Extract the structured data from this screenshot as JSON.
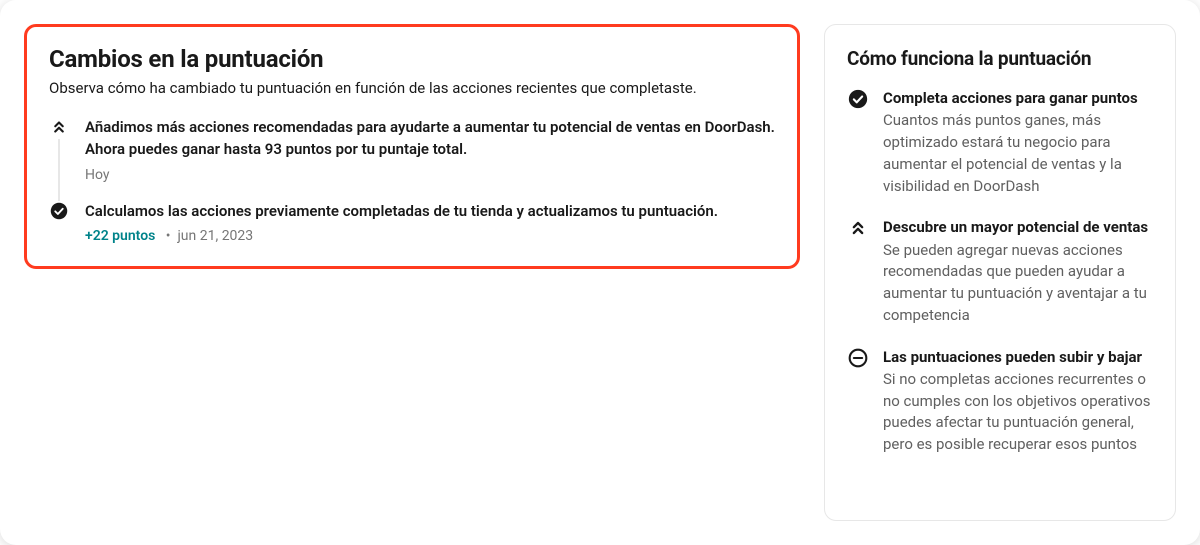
{
  "left": {
    "title": "Cambios en la puntuación",
    "subtitle": "Observa cómo ha cambiado tu puntuación en función de las acciones recientes que completaste.",
    "timeline": [
      {
        "icon": "chevrons-up",
        "text": "Añadimos más acciones recomendadas para ayudarte a aumentar tu potencial de ventas en DoorDash. Ahora puedes ganar hasta 93 puntos por tu puntaje total.",
        "date": "Hoy",
        "points": ""
      },
      {
        "icon": "check-filled",
        "text": "Calculamos las acciones previamente completadas de tu tienda y actualizamos tu puntuación.",
        "date": "jun 21, 2023",
        "points": "+22 puntos"
      }
    ]
  },
  "right": {
    "title": "Cómo funciona la puntuación",
    "items": [
      {
        "icon": "check-filled",
        "title": "Completa acciones para ganar puntos",
        "body": "Cuantos más puntos ganes, más optimizado estará tu negocio para aumentar el potencial de ventas y la visibilidad en DoorDash"
      },
      {
        "icon": "chevrons-up",
        "title": "Descubre un mayor potencial de ventas",
        "body": "Se pueden agregar nuevas acciones recomendadas que pueden ayudar a aumentar tu puntuación y aventajar a tu competencia"
      },
      {
        "icon": "minus-circle",
        "title": "Las puntuaciones pueden subir y bajar",
        "body": "Si no completas acciones recurrentes o no cumples con los objetivos operativos puedes afectar tu puntuación general, pero es posible recuperar esos puntos"
      }
    ]
  }
}
